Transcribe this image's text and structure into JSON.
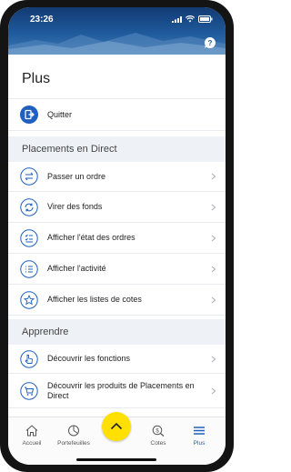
{
  "status_bar": {
    "time": "23:26"
  },
  "page": {
    "title": "Plus"
  },
  "quit": {
    "label": "Quitter"
  },
  "sections": [
    {
      "title": "Placements en Direct",
      "items": [
        {
          "label": "Passer un ordre",
          "icon": "swap-arrows-icon"
        },
        {
          "label": "Virer des fonds",
          "icon": "refresh-icon"
        },
        {
          "label": "Afficher l'état des ordres",
          "icon": "checklist-icon"
        },
        {
          "label": "Afficher l'activité",
          "icon": "list-icon"
        },
        {
          "label": "Afficher les listes de cotes",
          "icon": "star-icon"
        }
      ]
    },
    {
      "title": "Apprendre",
      "items": [
        {
          "label": "Découvrir les fonctions",
          "icon": "pointer-icon"
        },
        {
          "label": "Découvrir les produits de Placements en Direct",
          "icon": "cart-icon"
        }
      ]
    }
  ],
  "tabbar": {
    "items": [
      {
        "label": "Accueil",
        "icon": "home-icon"
      },
      {
        "label": "Portefeuilles",
        "icon": "pie-chart-icon"
      },
      {
        "label": "Cotes",
        "icon": "dollar-search-icon"
      },
      {
        "label": "Plus",
        "icon": "menu-icon",
        "active": true
      }
    ],
    "center_action": "chevron-up-icon"
  },
  "colors": {
    "accent": "#1f5fbf",
    "header": "#1f5a9c",
    "fab": "#ffe000",
    "section_bg": "#eef2f6"
  }
}
